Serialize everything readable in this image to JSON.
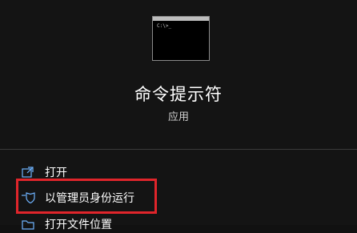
{
  "app": {
    "title": "命令提示符",
    "subtitle": "应用",
    "icon": "command-prompt-icon",
    "icon_prompt": "C:\\>_"
  },
  "actions": [
    {
      "label": "打开",
      "icon": "open-icon"
    },
    {
      "label": "以管理员身份运行",
      "icon": "shield-admin-icon"
    },
    {
      "label": "打开文件位置",
      "icon": "folder-location-icon"
    }
  ],
  "colors": {
    "background": "#141414",
    "text": "#ffffff",
    "highlight": "#e0252b",
    "divider": "#3a3a3a"
  }
}
